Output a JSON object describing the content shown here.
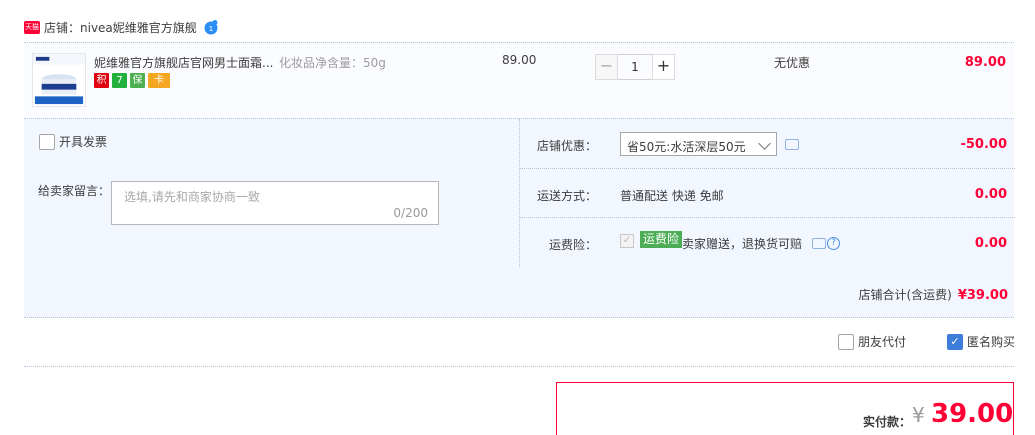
{
  "shop": {
    "badge": "天猫",
    "label": "店铺：nivea妮维雅官方旗舰"
  },
  "item": {
    "title": "妮维雅官方旗舰店官网男士面霜...",
    "sku": "化妆品净含量：50g",
    "price": "89.00",
    "quantity": "1",
    "promotion": "无优惠",
    "subtotal": "89.00",
    "service_icons": [
      {
        "label": "积",
        "color": "#e0000f"
      },
      {
        "label": "7",
        "color": "#21b13c"
      },
      {
        "label": "保",
        "color": "#4caf50"
      },
      {
        "label": "卡",
        "color": "#f5a623"
      }
    ]
  },
  "invoice": {
    "label": "开具发票"
  },
  "message": {
    "label": "给卖家留言：",
    "placeholder": "选填,请先和商家协商一致",
    "count": "0/200"
  },
  "discount": {
    "label": "店铺优惠：",
    "selected": "省50元:水活深层50元",
    "amount": "-50.00"
  },
  "shipping": {
    "label": "运送方式：",
    "value": "普通配送 快递 免邮",
    "amount": "0.00"
  },
  "insurance": {
    "label": "运费险：",
    "tag": "运费险",
    "text": "卖家赠送，退换货可赔",
    "amount": "0.00"
  },
  "shop_total": {
    "label": "店铺合计(含运费)",
    "amount": "¥39.00"
  },
  "options": {
    "friend_pay": "朋友代付",
    "anonymous": "匿名购买"
  },
  "payment": {
    "label": "实付款：",
    "currency": "¥",
    "amount": "39.00"
  },
  "colors": {
    "accent": "#ff0036",
    "panel": "#f2f7ff",
    "checked": "#3f7ddb"
  }
}
